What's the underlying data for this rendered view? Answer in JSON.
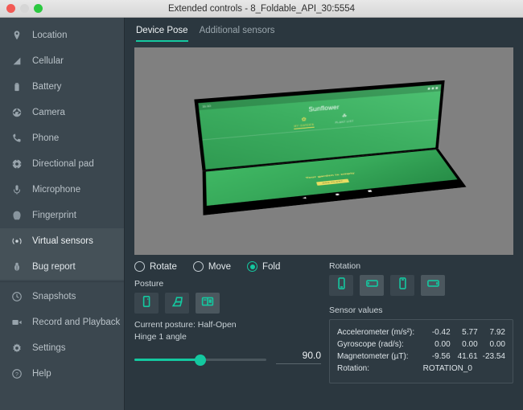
{
  "window": {
    "title": "Extended controls - 8_Foldable_API_30:5554",
    "traffic_lights": [
      "close",
      "minimize",
      "zoom"
    ]
  },
  "sidebar": {
    "items": [
      {
        "label": "Location",
        "icon": "location-pin-icon",
        "state": "normal"
      },
      {
        "label": "Cellular",
        "icon": "cellular-signal-icon",
        "state": "normal"
      },
      {
        "label": "Battery",
        "icon": "battery-icon",
        "state": "normal"
      },
      {
        "label": "Camera",
        "icon": "camera-aperture-icon",
        "state": "normal"
      },
      {
        "label": "Phone",
        "icon": "phone-handset-icon",
        "state": "normal"
      },
      {
        "label": "Directional pad",
        "icon": "dpad-icon",
        "state": "normal"
      },
      {
        "label": "Microphone",
        "icon": "microphone-icon",
        "state": "normal"
      },
      {
        "label": "Fingerprint",
        "icon": "fingerprint-icon",
        "state": "normal"
      },
      {
        "label": "Virtual sensors",
        "icon": "virtual-sensors-icon",
        "state": "active"
      },
      {
        "label": "Bug report",
        "icon": "bug-icon",
        "state": "hover"
      },
      {
        "label": "Snapshots",
        "icon": "clock-history-icon",
        "state": "normal"
      },
      {
        "label": "Record and Playback",
        "icon": "video-camera-icon",
        "state": "normal"
      },
      {
        "label": "Settings",
        "icon": "gear-icon",
        "state": "normal"
      },
      {
        "label": "Help",
        "icon": "question-circle-icon",
        "state": "normal"
      }
    ]
  },
  "tabs": [
    {
      "label": "Device Pose",
      "active": true
    },
    {
      "label": "Additional sensors",
      "active": false
    }
  ],
  "device_preview": {
    "app_name": "Sunflower",
    "app_tabs": [
      {
        "label": "MY GARDEN",
        "glyph": "✿",
        "active": true
      },
      {
        "label": "PLANT LIST",
        "glyph": "☘",
        "active": false
      }
    ],
    "empty_message": "Your garden is empty",
    "add_button": "ADD PLANT",
    "status_time": "11:10"
  },
  "pose_modes": [
    {
      "label": "Rotate",
      "selected": false
    },
    {
      "label": "Move",
      "selected": false
    },
    {
      "label": "Fold",
      "selected": true
    }
  ],
  "posture": {
    "section_label": "Posture",
    "buttons": [
      {
        "icon": "posture-closed-icon",
        "selected": false
      },
      {
        "icon": "posture-flipped-icon",
        "selected": false
      },
      {
        "icon": "posture-open-book-icon",
        "selected": true
      }
    ],
    "current_label": "Current posture: Half-Open",
    "hinge_label": "Hinge 1 angle",
    "hinge_value": "90.0",
    "hinge_percent": 50
  },
  "rotation": {
    "section_label": "Rotation",
    "buttons": [
      {
        "icon": "rotation-portrait-icon",
        "selected": false
      },
      {
        "icon": "rotation-landscape-icon",
        "selected": true
      },
      {
        "icon": "rotation-portrait-reverse-icon",
        "selected": false
      },
      {
        "icon": "rotation-landscape-reverse-icon",
        "selected": true
      }
    ]
  },
  "sensor_values": {
    "section_label": "Sensor values",
    "rows": [
      {
        "name": "Accelerometer (m/s²):",
        "x": "-0.42",
        "y": "5.77",
        "z": "7.92"
      },
      {
        "name": "Gyroscope (rad/s):",
        "x": "0.00",
        "y": "0.00",
        "z": "0.00"
      },
      {
        "name": "Magnetometer (µT):",
        "x": "-9.56",
        "y": "41.61",
        "z": "-23.54"
      }
    ],
    "rotation_row": {
      "name": "Rotation:",
      "value": "ROTATION_0"
    }
  },
  "colors": {
    "accent": "#14c8a0",
    "panel_bg": "#2b373f",
    "sidebar_bg": "#3b474f",
    "viewport_bg": "#808080",
    "screen_green": "#3fb763"
  }
}
